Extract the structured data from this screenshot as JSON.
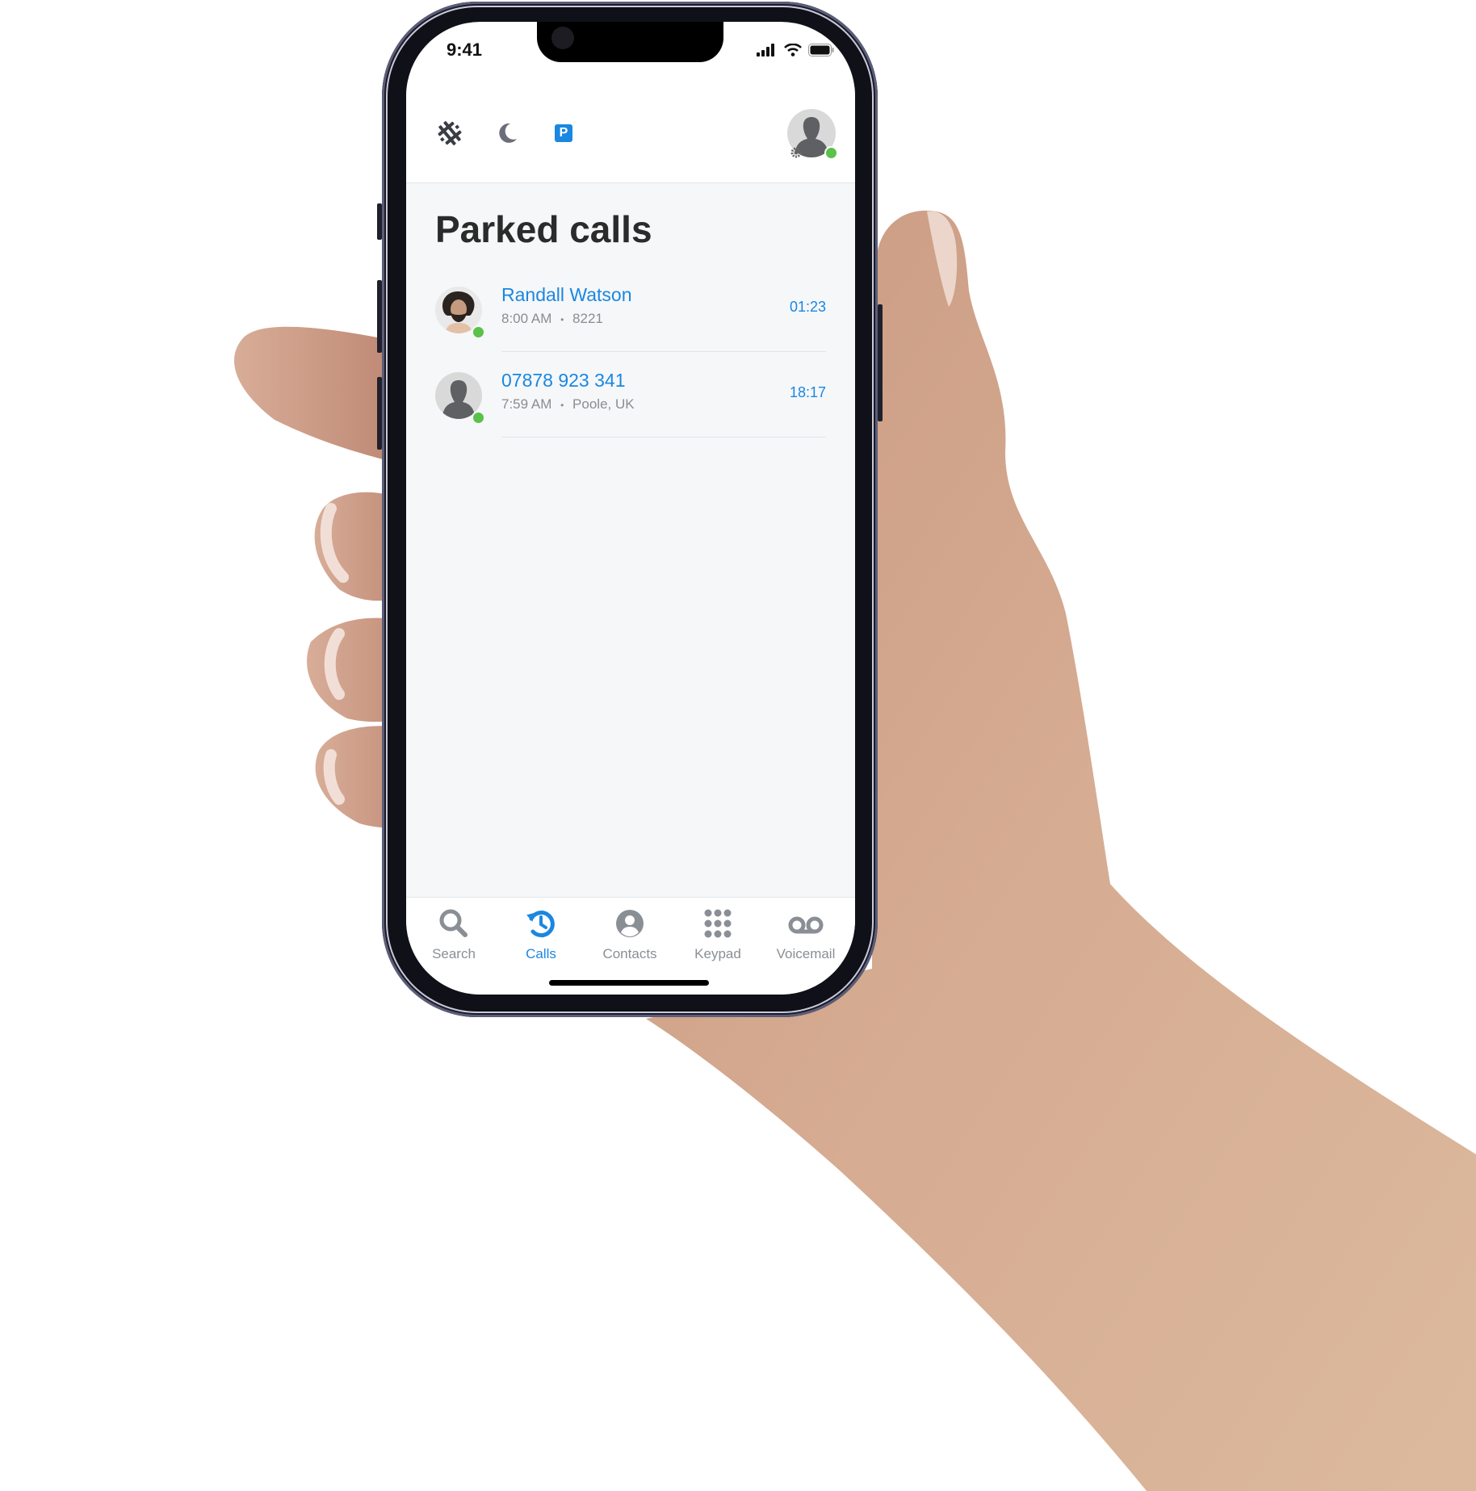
{
  "status_bar": {
    "time": "9:41"
  },
  "top_bar": {
    "icons": [
      "hash-brand-icon",
      "moon-icon",
      "parking-icon"
    ],
    "parking_letter": "P",
    "user_presence": "online"
  },
  "page": {
    "title": "Parked calls"
  },
  "parked_calls": [
    {
      "name": "Randall Watson",
      "time": "8:00 AM",
      "detail": "8221",
      "duration": "01:23",
      "avatar": "photo",
      "presence": "online"
    },
    {
      "name": "07878 923 341",
      "time": "7:59 AM",
      "detail": "Poole, UK",
      "duration": "18:17",
      "avatar": "silhouette",
      "presence": "online"
    }
  ],
  "separator": "•",
  "nav": {
    "items": [
      {
        "label": "Search",
        "icon": "search-icon",
        "active": false
      },
      {
        "label": "Calls",
        "icon": "call-history-icon",
        "active": true
      },
      {
        "label": "Contacts",
        "icon": "contact-icon",
        "active": false
      },
      {
        "label": "Keypad",
        "icon": "keypad-icon",
        "active": false
      },
      {
        "label": "Voicemail",
        "icon": "voicemail-icon",
        "active": false
      }
    ]
  },
  "colors": {
    "accent": "#1b87e0",
    "presence": "#5ac14a",
    "title": "#2b2b2b",
    "muted": "#8a8d91",
    "background": "#f5f7f9"
  }
}
